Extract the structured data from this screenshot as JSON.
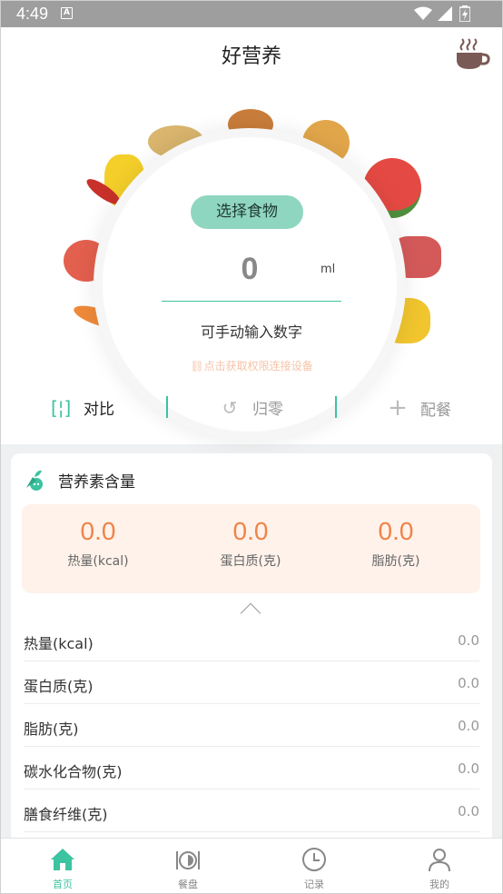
{
  "status_bar": {
    "time": "4:49",
    "notification_icon": "a-icon"
  },
  "header": {
    "title": "好营养",
    "cup_icon": "coffee-cup-icon"
  },
  "scale": {
    "select_food_label": "选择食物",
    "value": "0",
    "unit": "ml",
    "manual_input_hint": "可手动输入数字",
    "permission_hint": "点击获取权限连接设备"
  },
  "actions": [
    {
      "label": "对比",
      "icon": "compare-icon"
    },
    {
      "label": "归零",
      "icon": "reset-icon"
    },
    {
      "label": "配餐",
      "icon": "plus-icon"
    }
  ],
  "nutrition": {
    "title": "营养素含量",
    "summary": [
      {
        "value": "0.0",
        "label": "热量(kcal)"
      },
      {
        "value": "0.0",
        "label": "蛋白质(克)"
      },
      {
        "value": "0.0",
        "label": "脂肪(克)"
      }
    ],
    "rows": [
      {
        "name": "热量(kcal)",
        "value": "0.0"
      },
      {
        "name": "蛋白质(克)",
        "value": "0.0"
      },
      {
        "name": "脂肪(克)",
        "value": "0.0"
      },
      {
        "name": "碳水化合物(克)",
        "value": "0.0"
      },
      {
        "name": "膳食纤维(克)",
        "value": "0.0"
      }
    ]
  },
  "bottom_nav": [
    {
      "label": "首页",
      "icon": "home-icon",
      "active": true
    },
    {
      "label": "餐盘",
      "icon": "plate-icon",
      "active": false
    },
    {
      "label": "记录",
      "icon": "clock-icon",
      "active": false
    },
    {
      "label": "我的",
      "icon": "user-icon",
      "active": false
    }
  ],
  "colors": {
    "accent": "#3cc3a0",
    "button": "#8fd6c1",
    "orange": "#f08348",
    "summary_bg": "#fff2ea"
  }
}
